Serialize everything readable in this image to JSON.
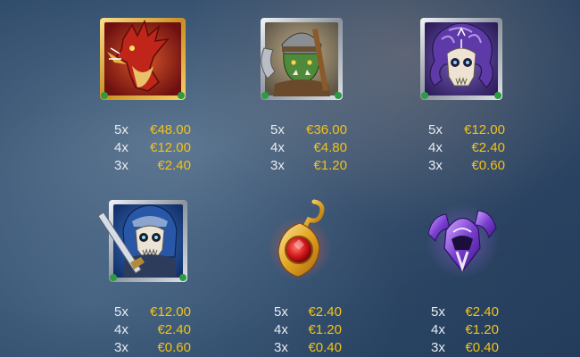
{
  "symbols": [
    {
      "name": "dragon",
      "payouts": [
        {
          "count": "5x",
          "amount": "€48.00"
        },
        {
          "count": "4x",
          "amount": "€12.00"
        },
        {
          "count": "3x",
          "amount": "€2.40"
        }
      ]
    },
    {
      "name": "orc",
      "payouts": [
        {
          "count": "5x",
          "amount": "€36.00"
        },
        {
          "count": "4x",
          "amount": "€4.80"
        },
        {
          "count": "3x",
          "amount": "€1.20"
        }
      ]
    },
    {
      "name": "medusa-skull",
      "payouts": [
        {
          "count": "5x",
          "amount": "€12.00"
        },
        {
          "count": "4x",
          "amount": "€2.40"
        },
        {
          "count": "3x",
          "amount": "€0.60"
        }
      ]
    },
    {
      "name": "skeleton-knight",
      "payouts": [
        {
          "count": "5x",
          "amount": "€12.00"
        },
        {
          "count": "4x",
          "amount": "€2.40"
        },
        {
          "count": "3x",
          "amount": "€0.60"
        }
      ]
    },
    {
      "name": "ruby-amulet",
      "payouts": [
        {
          "count": "5x",
          "amount": "€2.40"
        },
        {
          "count": "4x",
          "amount": "€1.20"
        },
        {
          "count": "3x",
          "amount": "€0.40"
        }
      ]
    },
    {
      "name": "winged-helmet",
      "payouts": [
        {
          "count": "5x",
          "amount": "€2.40"
        },
        {
          "count": "4x",
          "amount": "€1.20"
        },
        {
          "count": "3x",
          "amount": "€0.40"
        }
      ]
    }
  ],
  "colors": {
    "multiplier": "#e9edf2",
    "payout": "#f2c318"
  }
}
